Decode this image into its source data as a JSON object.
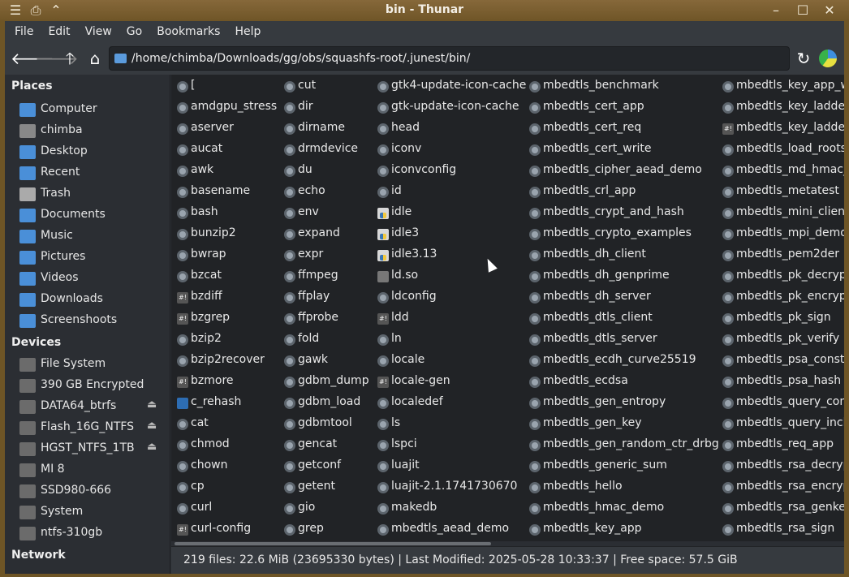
{
  "window": {
    "title": "bin - Thunar"
  },
  "titlebar_buttons": [
    "menu-icon",
    "sticky-icon",
    "shade-icon",
    "minimize-icon",
    "maximize-icon",
    "close-icon"
  ],
  "menubar": [
    "File",
    "Edit",
    "View",
    "Go",
    "Bookmarks",
    "Help"
  ],
  "toolbar": {
    "path": "/home/chimba/Downloads/gg/obs/squashfs-root/.junest/bin/"
  },
  "sidebar": {
    "places_header": "Places",
    "places": [
      {
        "label": "Computer",
        "color": "#4a8fd8"
      },
      {
        "label": "chimba",
        "color": "#888888"
      },
      {
        "label": "Desktop",
        "color": "#4a8fd8"
      },
      {
        "label": "Recent",
        "color": "#4a8fd8"
      },
      {
        "label": "Trash",
        "color": "#aaaaaa"
      },
      {
        "label": "Documents",
        "color": "#4a8fd8"
      },
      {
        "label": "Music",
        "color": "#4a8fd8"
      },
      {
        "label": "Pictures",
        "color": "#4a8fd8"
      },
      {
        "label": "Videos",
        "color": "#4a8fd8"
      },
      {
        "label": "Downloads",
        "color": "#4a8fd8"
      },
      {
        "label": "Screenshoots",
        "color": "#4a8fd8"
      }
    ],
    "devices_header": "Devices",
    "devices": [
      {
        "label": "File System",
        "eject": false
      },
      {
        "label": "390 GB Encrypted",
        "eject": false
      },
      {
        "label": "DATA64_btrfs",
        "eject": true
      },
      {
        "label": "Flash_16G_NTFS",
        "eject": true
      },
      {
        "label": "HGST_NTFS_1TB",
        "eject": true
      },
      {
        "label": "MI 8",
        "eject": false
      },
      {
        "label": "SSD980-666",
        "eject": false
      },
      {
        "label": "System",
        "eject": false
      },
      {
        "label": "ntfs-310gb",
        "eject": false
      }
    ],
    "network_header": "Network"
  },
  "files": [
    [
      [
        "[",
        "g"
      ],
      [
        "amdgpu_stress",
        "g"
      ],
      [
        "aserver",
        "g"
      ],
      [
        "aucat",
        "g"
      ],
      [
        "awk",
        "g"
      ],
      [
        "basename",
        "g"
      ],
      [
        "bash",
        "g"
      ],
      [
        "bunzip2",
        "g"
      ],
      [
        "bwrap",
        "g"
      ],
      [
        "bzcat",
        "g"
      ],
      [
        "bzdiff",
        "s"
      ],
      [
        "bzgrep",
        "s"
      ],
      [
        "bzip2",
        "g"
      ],
      [
        "bzip2recover",
        "g"
      ],
      [
        "bzmore",
        "s"
      ],
      [
        "c_rehash",
        "r"
      ],
      [
        "cat",
        "g"
      ],
      [
        "chmod",
        "g"
      ],
      [
        "chown",
        "g"
      ],
      [
        "cp",
        "g"
      ],
      [
        "curl",
        "g"
      ],
      [
        "curl-config",
        "s"
      ]
    ],
    [
      [
        "cut",
        "g"
      ],
      [
        "dir",
        "g"
      ],
      [
        "dirname",
        "g"
      ],
      [
        "drmdevice",
        "g"
      ],
      [
        "du",
        "g"
      ],
      [
        "echo",
        "g"
      ],
      [
        "env",
        "g"
      ],
      [
        "expand",
        "g"
      ],
      [
        "expr",
        "g"
      ],
      [
        "ffmpeg",
        "g"
      ],
      [
        "ffplay",
        "g"
      ],
      [
        "ffprobe",
        "g"
      ],
      [
        "fold",
        "g"
      ],
      [
        "gawk",
        "g"
      ],
      [
        "gdbm_dump",
        "g"
      ],
      [
        "gdbm_load",
        "g"
      ],
      [
        "gdbmtool",
        "g"
      ],
      [
        "gencat",
        "g"
      ],
      [
        "getconf",
        "g"
      ],
      [
        "getent",
        "g"
      ],
      [
        "gio",
        "g"
      ],
      [
        "grep",
        "g"
      ]
    ],
    [
      [
        "gtk4-update-icon-cache",
        "g"
      ],
      [
        "gtk-update-icon-cache",
        "g"
      ],
      [
        "head",
        "g"
      ],
      [
        "iconv",
        "g"
      ],
      [
        "iconvconfig",
        "g"
      ],
      [
        "id",
        "g"
      ],
      [
        "idle",
        "p"
      ],
      [
        "idle3",
        "p"
      ],
      [
        "idle3.13",
        "p"
      ],
      [
        "ld.so",
        "l"
      ],
      [
        "ldconfig",
        "g"
      ],
      [
        "ldd",
        "s"
      ],
      [
        "ln",
        "g"
      ],
      [
        "locale",
        "g"
      ],
      [
        "locale-gen",
        "s"
      ],
      [
        "localedef",
        "g"
      ],
      [
        "ls",
        "g"
      ],
      [
        "lspci",
        "g"
      ],
      [
        "luajit",
        "g"
      ],
      [
        "luajit-2.1.1741730670",
        "g"
      ],
      [
        "makedb",
        "g"
      ],
      [
        "mbedtls_aead_demo",
        "g"
      ]
    ],
    [
      [
        "mbedtls_benchmark",
        "g"
      ],
      [
        "mbedtls_cert_app",
        "g"
      ],
      [
        "mbedtls_cert_req",
        "g"
      ],
      [
        "mbedtls_cert_write",
        "g"
      ],
      [
        "mbedtls_cipher_aead_demo",
        "g"
      ],
      [
        "mbedtls_crl_app",
        "g"
      ],
      [
        "mbedtls_crypt_and_hash",
        "g"
      ],
      [
        "mbedtls_crypto_examples",
        "g"
      ],
      [
        "mbedtls_dh_client",
        "g"
      ],
      [
        "mbedtls_dh_genprime",
        "g"
      ],
      [
        "mbedtls_dh_server",
        "g"
      ],
      [
        "mbedtls_dtls_client",
        "g"
      ],
      [
        "mbedtls_dtls_server",
        "g"
      ],
      [
        "mbedtls_ecdh_curve25519",
        "g"
      ],
      [
        "mbedtls_ecdsa",
        "g"
      ],
      [
        "mbedtls_gen_entropy",
        "g"
      ],
      [
        "mbedtls_gen_key",
        "g"
      ],
      [
        "mbedtls_gen_random_ctr_drbg",
        "g"
      ],
      [
        "mbedtls_generic_sum",
        "g"
      ],
      [
        "mbedtls_hello",
        "g"
      ],
      [
        "mbedtls_hmac_demo",
        "g"
      ],
      [
        "mbedtls_key_app",
        "g"
      ]
    ],
    [
      [
        "mbedtls_key_app_w",
        "g"
      ],
      [
        "mbedtls_key_ladder",
        "g"
      ],
      [
        "mbedtls_key_ladder",
        "s"
      ],
      [
        "mbedtls_load_roots",
        "g"
      ],
      [
        "mbedtls_md_hmac_",
        "g"
      ],
      [
        "mbedtls_metatest",
        "g"
      ],
      [
        "mbedtls_mini_client",
        "g"
      ],
      [
        "mbedtls_mpi_demo",
        "g"
      ],
      [
        "mbedtls_pem2der",
        "g"
      ],
      [
        "mbedtls_pk_decrypt",
        "g"
      ],
      [
        "mbedtls_pk_encrypt",
        "g"
      ],
      [
        "mbedtls_pk_sign",
        "g"
      ],
      [
        "mbedtls_pk_verify",
        "g"
      ],
      [
        "mbedtls_psa_consta",
        "g"
      ],
      [
        "mbedtls_psa_hash",
        "g"
      ],
      [
        "mbedtls_query_com",
        "g"
      ],
      [
        "mbedtls_query_incl",
        "g"
      ],
      [
        "mbedtls_req_app",
        "g"
      ],
      [
        "mbedtls_rsa_decryp",
        "g"
      ],
      [
        "mbedtls_rsa_encryp",
        "g"
      ],
      [
        "mbedtls_rsa_genkey",
        "g"
      ],
      [
        "mbedtls_rsa_sign",
        "g"
      ]
    ]
  ],
  "status": "219 files: 22.6 MiB (23695330 bytes)  |  Last Modified: 2025-05-28 10:33:37  |  Free space: 57.5 GiB"
}
